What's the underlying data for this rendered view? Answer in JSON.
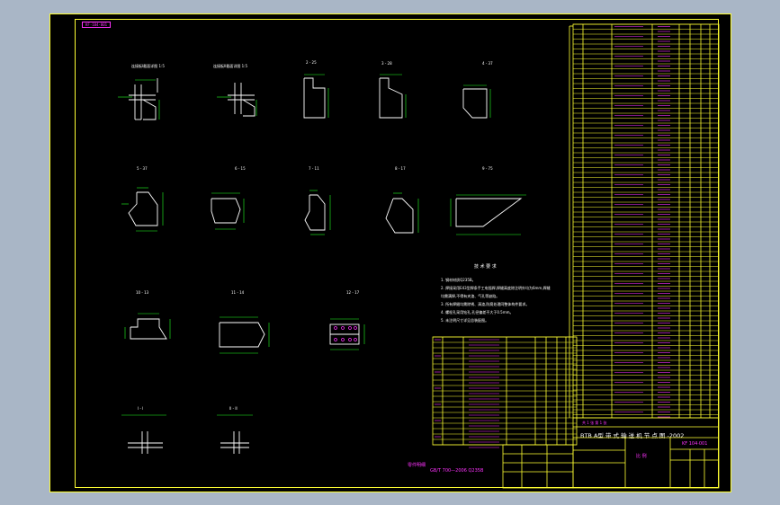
{
  "drawing": {
    "corner_tag": "KF·104·001",
    "section_labels": [
      "连接板I截面详图 1:5",
      "连接板II截面详图 1:5",
      "2 - 25",
      "3 - 28",
      "4 - 37",
      "5 - 37",
      "6 - 15",
      "7 - 11",
      "8 - 17",
      "9 - 75",
      "10 - 13",
      "11 - 14",
      "12 - 17",
      "I - I",
      "II - II"
    ],
    "notes_title": "技 术 要 求",
    "notes": [
      "1. 钢材材质Q235B。",
      "2. 焊接采用E43型焊条手工电弧焊,焊缝高度除注明外均为6mm,焊缝",
      "   均需满焊,不得有夹渣、气孔等缺陷。",
      "3. 所有焊缝均需除锈、清渣,防腐处理同整体构件要求。",
      "4. 螺栓孔采用钻孔,孔径偏差不大于0.5mm。",
      "5. 未注明尺寸详见总装配图。"
    ],
    "bottom_tags": [
      "零件明细",
      "GB/T 700—2006  Q235B"
    ],
    "title_block": {
      "company": "BTB A型 带 式 输 送 机 节 点 图 -2002",
      "part_no": "KF 104·001",
      "scale": "比 例",
      "sheet": "共 1 张  第 1 张"
    }
  }
}
